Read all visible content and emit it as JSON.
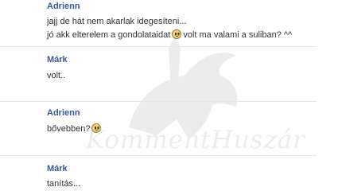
{
  "messages": [
    {
      "author": "Adrienn",
      "lines": [
        {
          "text": "jajj de hát nem akarlak idegesíteni..."
        },
        {
          "before": "jó akk elterelem a gondolataidat",
          "icon": "smiley-icon",
          "after": "volt ma valami a suliban? ^^"
        }
      ]
    },
    {
      "author": "Márk",
      "lines": [
        {
          "text": "volt.."
        }
      ]
    },
    {
      "author": "Adrienn",
      "lines": [
        {
          "before": "bővebben?",
          "icon": "smiley-icon",
          "after": ""
        }
      ]
    },
    {
      "author": "Márk",
      "lines": [
        {
          "text": "tanítás..."
        }
      ]
    }
  ],
  "watermark": {
    "text": "KommentHuszár",
    "icon": "hussar-rider-icon"
  },
  "colors": {
    "author": "#3b5998",
    "text": "#333333",
    "divider": "#e6e6e6"
  }
}
